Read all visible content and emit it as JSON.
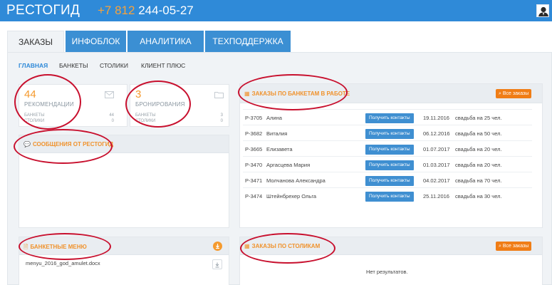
{
  "header": {
    "brand": "РЕСТОГИД",
    "phone_prefix": "+7 812",
    "phone_number": "244-05-27"
  },
  "tabs": [
    {
      "label": "ЗАКАЗЫ",
      "active": true
    },
    {
      "label": "ИНФОБЛОК",
      "active": false
    },
    {
      "label": "АНАЛИТИКА",
      "active": false
    },
    {
      "label": "ТЕХПОДДЕРЖКА",
      "active": false
    }
  ],
  "subnav": [
    "ГЛАВНАЯ",
    "БАНКЕТЫ",
    "СТОЛИКИ",
    "КЛИЕНТ ПЛЮС"
  ],
  "stats": [
    {
      "value": "44",
      "label": "РЕКОМЕНДАЦИИ",
      "rows": [
        {
          "name": "БАНКЕТЫ",
          "value": "44"
        },
        {
          "name": "СТОЛИКИ",
          "value": "0"
        }
      ]
    },
    {
      "value": "3",
      "label": "БРОНИРОВАНИЯ",
      "rows": [
        {
          "name": "БАНКЕТЫ",
          "value": "3"
        },
        {
          "name": "СТОЛИКИ",
          "value": "0"
        }
      ]
    }
  ],
  "messages": {
    "title": "СООБЩЕНИЯ ОТ РЕСТОГИД"
  },
  "banquet_orders": {
    "title": "ЗАКАЗЫ ПО БАНКЕТАМ В РАБОТЕ",
    "all_button": "Все заказы",
    "get_contacts_label": "Получить контакты",
    "rows": [
      {
        "id": "Р-3705",
        "name": "Алина",
        "date": "19.11.2016",
        "event": "свадьба на 25 чел."
      },
      {
        "id": "Р-3682",
        "name": "Виталия",
        "date": "06.12.2016",
        "event": "свадьба на 50 чел."
      },
      {
        "id": "Р-3665",
        "name": "Елизавета",
        "date": "01.07.2017",
        "event": "свадьба на 20 чел."
      },
      {
        "id": "Р-3470",
        "name": "Аргасцева Мария",
        "date": "01.03.2017",
        "event": "свадьба на 20 чел."
      },
      {
        "id": "Р-3471",
        "name": "Молчанова Александра",
        "date": "04.02.2017",
        "event": "свадьба на 70 чел."
      },
      {
        "id": "Р-3474",
        "name": "Штейнбрехер Ольга",
        "date": "25.11.2016",
        "event": "свадьба на 30 чел."
      }
    ]
  },
  "banquet_menu": {
    "title": "БАНКЕТНЫЕ МЕНЮ",
    "file": "menyu_2016_god_amulet.docx"
  },
  "table_orders": {
    "title": "ЗАКАЗЫ ПО СТОЛИКАМ",
    "all_button": "Все заказы",
    "empty": "Нет результатов."
  },
  "colors": {
    "header_blue": "#2f8ad8",
    "accent_orange": "#f07d16",
    "annotation_red": "#c8102e"
  }
}
